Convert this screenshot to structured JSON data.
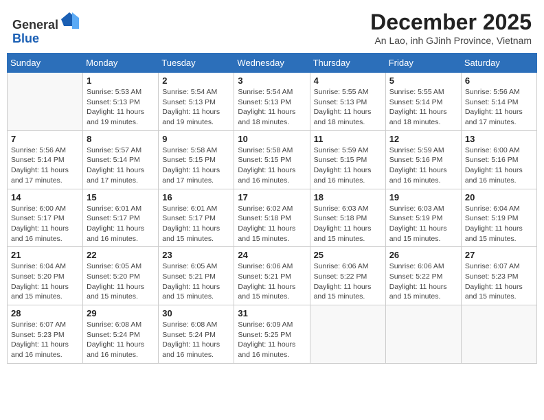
{
  "header": {
    "logo_line1": "General",
    "logo_line2": "Blue",
    "title": "December 2025",
    "subtitle": "An Lao, inh GJinh Province, Vietnam"
  },
  "days_of_week": [
    "Sunday",
    "Monday",
    "Tuesday",
    "Wednesday",
    "Thursday",
    "Friday",
    "Saturday"
  ],
  "weeks": [
    [
      {
        "day": "",
        "info": ""
      },
      {
        "day": "1",
        "info": "Sunrise: 5:53 AM\nSunset: 5:13 PM\nDaylight: 11 hours\nand 19 minutes."
      },
      {
        "day": "2",
        "info": "Sunrise: 5:54 AM\nSunset: 5:13 PM\nDaylight: 11 hours\nand 19 minutes."
      },
      {
        "day": "3",
        "info": "Sunrise: 5:54 AM\nSunset: 5:13 PM\nDaylight: 11 hours\nand 18 minutes."
      },
      {
        "day": "4",
        "info": "Sunrise: 5:55 AM\nSunset: 5:13 PM\nDaylight: 11 hours\nand 18 minutes."
      },
      {
        "day": "5",
        "info": "Sunrise: 5:55 AM\nSunset: 5:14 PM\nDaylight: 11 hours\nand 18 minutes."
      },
      {
        "day": "6",
        "info": "Sunrise: 5:56 AM\nSunset: 5:14 PM\nDaylight: 11 hours\nand 17 minutes."
      }
    ],
    [
      {
        "day": "7",
        "info": "Sunrise: 5:56 AM\nSunset: 5:14 PM\nDaylight: 11 hours\nand 17 minutes."
      },
      {
        "day": "8",
        "info": "Sunrise: 5:57 AM\nSunset: 5:14 PM\nDaylight: 11 hours\nand 17 minutes."
      },
      {
        "day": "9",
        "info": "Sunrise: 5:58 AM\nSunset: 5:15 PM\nDaylight: 11 hours\nand 17 minutes."
      },
      {
        "day": "10",
        "info": "Sunrise: 5:58 AM\nSunset: 5:15 PM\nDaylight: 11 hours\nand 16 minutes."
      },
      {
        "day": "11",
        "info": "Sunrise: 5:59 AM\nSunset: 5:15 PM\nDaylight: 11 hours\nand 16 minutes."
      },
      {
        "day": "12",
        "info": "Sunrise: 5:59 AM\nSunset: 5:16 PM\nDaylight: 11 hours\nand 16 minutes."
      },
      {
        "day": "13",
        "info": "Sunrise: 6:00 AM\nSunset: 5:16 PM\nDaylight: 11 hours\nand 16 minutes."
      }
    ],
    [
      {
        "day": "14",
        "info": "Sunrise: 6:00 AM\nSunset: 5:17 PM\nDaylight: 11 hours\nand 16 minutes."
      },
      {
        "day": "15",
        "info": "Sunrise: 6:01 AM\nSunset: 5:17 PM\nDaylight: 11 hours\nand 16 minutes."
      },
      {
        "day": "16",
        "info": "Sunrise: 6:01 AM\nSunset: 5:17 PM\nDaylight: 11 hours\nand 15 minutes."
      },
      {
        "day": "17",
        "info": "Sunrise: 6:02 AM\nSunset: 5:18 PM\nDaylight: 11 hours\nand 15 minutes."
      },
      {
        "day": "18",
        "info": "Sunrise: 6:03 AM\nSunset: 5:18 PM\nDaylight: 11 hours\nand 15 minutes."
      },
      {
        "day": "19",
        "info": "Sunrise: 6:03 AM\nSunset: 5:19 PM\nDaylight: 11 hours\nand 15 minutes."
      },
      {
        "day": "20",
        "info": "Sunrise: 6:04 AM\nSunset: 5:19 PM\nDaylight: 11 hours\nand 15 minutes."
      }
    ],
    [
      {
        "day": "21",
        "info": "Sunrise: 6:04 AM\nSunset: 5:20 PM\nDaylight: 11 hours\nand 15 minutes."
      },
      {
        "day": "22",
        "info": "Sunrise: 6:05 AM\nSunset: 5:20 PM\nDaylight: 11 hours\nand 15 minutes."
      },
      {
        "day": "23",
        "info": "Sunrise: 6:05 AM\nSunset: 5:21 PM\nDaylight: 11 hours\nand 15 minutes."
      },
      {
        "day": "24",
        "info": "Sunrise: 6:06 AM\nSunset: 5:21 PM\nDaylight: 11 hours\nand 15 minutes."
      },
      {
        "day": "25",
        "info": "Sunrise: 6:06 AM\nSunset: 5:22 PM\nDaylight: 11 hours\nand 15 minutes."
      },
      {
        "day": "26",
        "info": "Sunrise: 6:06 AM\nSunset: 5:22 PM\nDaylight: 11 hours\nand 15 minutes."
      },
      {
        "day": "27",
        "info": "Sunrise: 6:07 AM\nSunset: 5:23 PM\nDaylight: 11 hours\nand 15 minutes."
      }
    ],
    [
      {
        "day": "28",
        "info": "Sunrise: 6:07 AM\nSunset: 5:23 PM\nDaylight: 11 hours\nand 16 minutes."
      },
      {
        "day": "29",
        "info": "Sunrise: 6:08 AM\nSunset: 5:24 PM\nDaylight: 11 hours\nand 16 minutes."
      },
      {
        "day": "30",
        "info": "Sunrise: 6:08 AM\nSunset: 5:24 PM\nDaylight: 11 hours\nand 16 minutes."
      },
      {
        "day": "31",
        "info": "Sunrise: 6:09 AM\nSunset: 5:25 PM\nDaylight: 11 hours\nand 16 minutes."
      },
      {
        "day": "",
        "info": ""
      },
      {
        "day": "",
        "info": ""
      },
      {
        "day": "",
        "info": ""
      }
    ]
  ]
}
